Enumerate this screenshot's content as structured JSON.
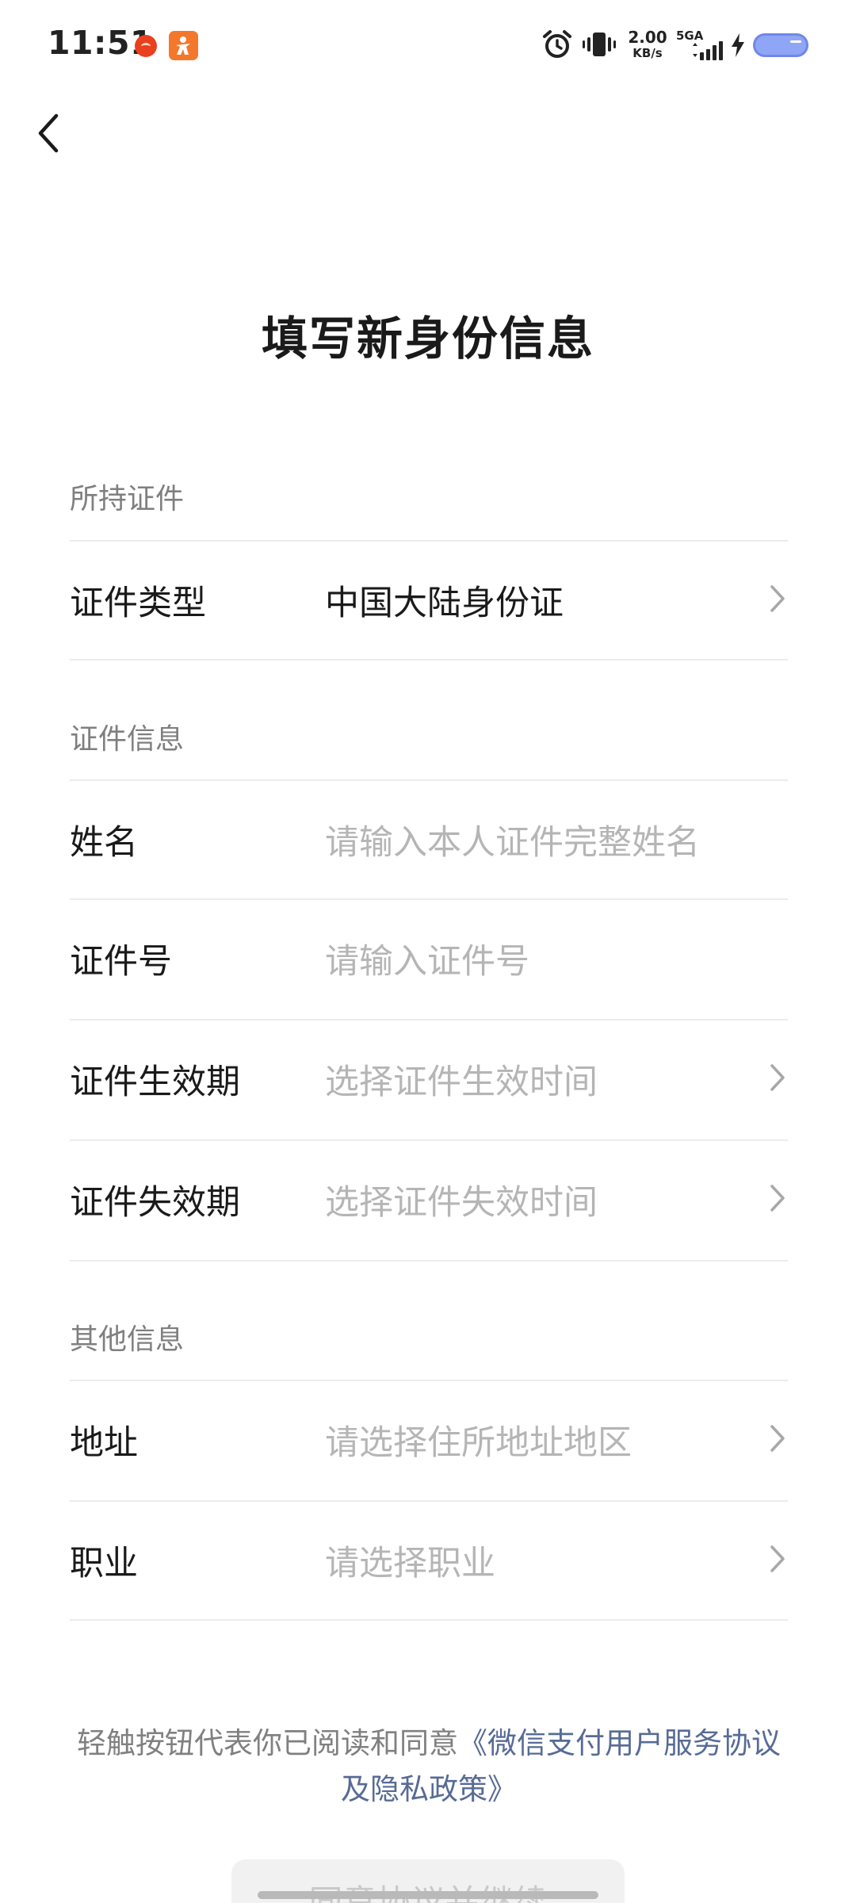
{
  "status_bar": {
    "time": "11:51",
    "net_speed_value": "2.00",
    "net_speed_unit": "KB/s",
    "network_type": "5GA",
    "icons": [
      "app-notification-icon",
      "app-notification-icon-2",
      "alarm-icon",
      "vibrate-icon",
      "signal-icon",
      "charging-icon",
      "battery-icon"
    ]
  },
  "header": {
    "back_icon": "chevron-left-icon",
    "title": "填写新身份信息"
  },
  "form": {
    "sections": [
      {
        "label": "所持证件",
        "rows": [
          {
            "label": "证件类型",
            "value": "中国大陆身份证",
            "placeholder": "",
            "has_chevron": true
          }
        ]
      },
      {
        "label": "证件信息",
        "rows": [
          {
            "label": "姓名",
            "value": "",
            "placeholder": "请输入本人证件完整姓名",
            "has_chevron": false
          },
          {
            "label": "证件号",
            "value": "",
            "placeholder": "请输入证件号",
            "has_chevron": false
          },
          {
            "label": "证件生效期",
            "value": "",
            "placeholder": "选择证件生效时间",
            "has_chevron": true
          },
          {
            "label": "证件失效期",
            "value": "",
            "placeholder": "选择证件失效时间",
            "has_chevron": true
          }
        ]
      },
      {
        "label": "其他信息",
        "rows": [
          {
            "label": "地址",
            "value": "",
            "placeholder": "请选择住所地址地区",
            "has_chevron": true
          },
          {
            "label": "职业",
            "value": "",
            "placeholder": "请选择职业",
            "has_chevron": true
          }
        ]
      }
    ]
  },
  "agreement": {
    "prefix": "轻触按钮代表你已阅读和同意",
    "link": "《微信支付用户服务协议及隐私政策》"
  },
  "confirm_button": {
    "label": "同意协议并继续"
  },
  "colors": {
    "link": "#576b95",
    "placeholder": "#b5b5b5",
    "section_label": "#7f7f7f",
    "divider": "#ececec"
  }
}
